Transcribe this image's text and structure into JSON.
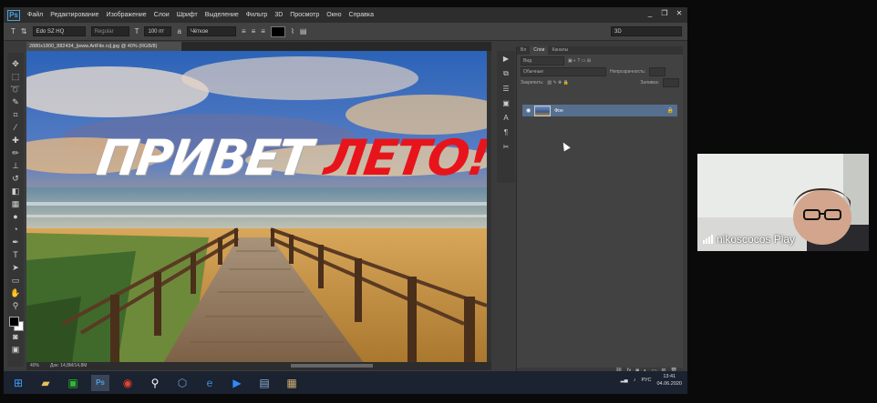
{
  "app": {
    "logo": "Ps",
    "menu": [
      "Файл",
      "Редактирование",
      "Изображение",
      "Слои",
      "Шрифт",
      "Выделение",
      "Фильтр",
      "3D",
      "Просмотр",
      "Окно",
      "Справка"
    ],
    "window_buttons": [
      "_",
      "❐",
      "✕"
    ]
  },
  "options_bar": {
    "tool_icon": "T",
    "font_name": "Edo SZ HQ",
    "font_style": "Regular",
    "font_size": "100 пт",
    "antialias": "Чёткое",
    "workspace": "3D"
  },
  "document": {
    "tab_title": "2880x1800_882434_[www.ArtFile.ru].jpg @ 40% (RGB/8)",
    "canvas_text_left": "ПРИВЕТ",
    "canvas_text_right": "ЛЕТО!",
    "zoom": "40%",
    "doc_size": "Док: 14,8М/14,8М"
  },
  "layers_panel": {
    "tabs": [
      "Вл",
      "Слои",
      "Каналы"
    ],
    "filter_label": "Вид",
    "blend_mode": "Обычные",
    "opacity_label": "Непрозрачность:",
    "lock_label": "Закрепить:",
    "fill_label": "Заливка:",
    "layer_name": "Фон"
  },
  "taskbar": {
    "language": "РУС",
    "time": "13:41",
    "date": "04.06.2020"
  },
  "webcam": {
    "participant_name": "nikoscocos Play"
  },
  "colors": {
    "accent": "#4aa3df",
    "text_red": "#e8141b",
    "text_white": "#ffffff"
  }
}
